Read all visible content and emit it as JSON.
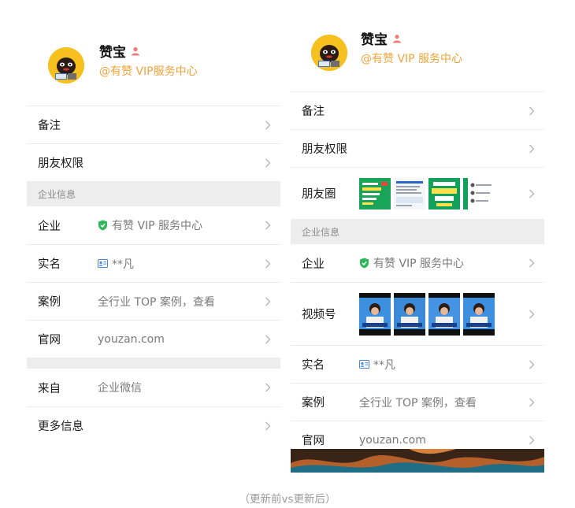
{
  "before": {
    "profile": {
      "name": "赞宝",
      "handle": "@有赞 VIP服务中心"
    },
    "rows_top": [
      {
        "label": "备注",
        "value": ""
      },
      {
        "label": "朋友权限",
        "value": ""
      }
    ],
    "section_title": "企业信息",
    "enterprise_rows": [
      {
        "label": "企业",
        "value": "有赞 VIP 服务中心",
        "icon": "shield-check-icon"
      },
      {
        "label": "实名",
        "value": "**凡",
        "icon": "id-card-icon"
      },
      {
        "label": "案例",
        "value": "全行业 TOP 案例，查看"
      },
      {
        "label": "官网",
        "value": "youzan.com"
      }
    ],
    "rows_bottom": [
      {
        "label": "来自",
        "value": "企业微信"
      },
      {
        "label": "更多信息",
        "value": ""
      }
    ]
  },
  "after": {
    "profile": {
      "name": "赞宝",
      "handle": "@有赞 VIP 服务中心"
    },
    "rows_top": [
      {
        "label": "备注"
      },
      {
        "label": "朋友权限"
      },
      {
        "label": "朋友圈"
      }
    ],
    "section_title": "企业信息",
    "enterprise_rows": [
      {
        "label": "企业",
        "value": "有赞 VIP 服务中心",
        "icon": "shield-check-icon"
      },
      {
        "label": "视频号"
      },
      {
        "label": "实名",
        "value": "**凡",
        "icon": "id-card-icon"
      },
      {
        "label": "案例",
        "value": "全行业 TOP 案例，查看"
      },
      {
        "label": "官网",
        "value": "youzan.com"
      }
    ]
  },
  "caption": "（更新前vs更新后）",
  "colors": {
    "accent": "#f0a33a",
    "shield": "#2fb85a",
    "idcard": "#4a86d8",
    "section_bg": "#ededed"
  }
}
